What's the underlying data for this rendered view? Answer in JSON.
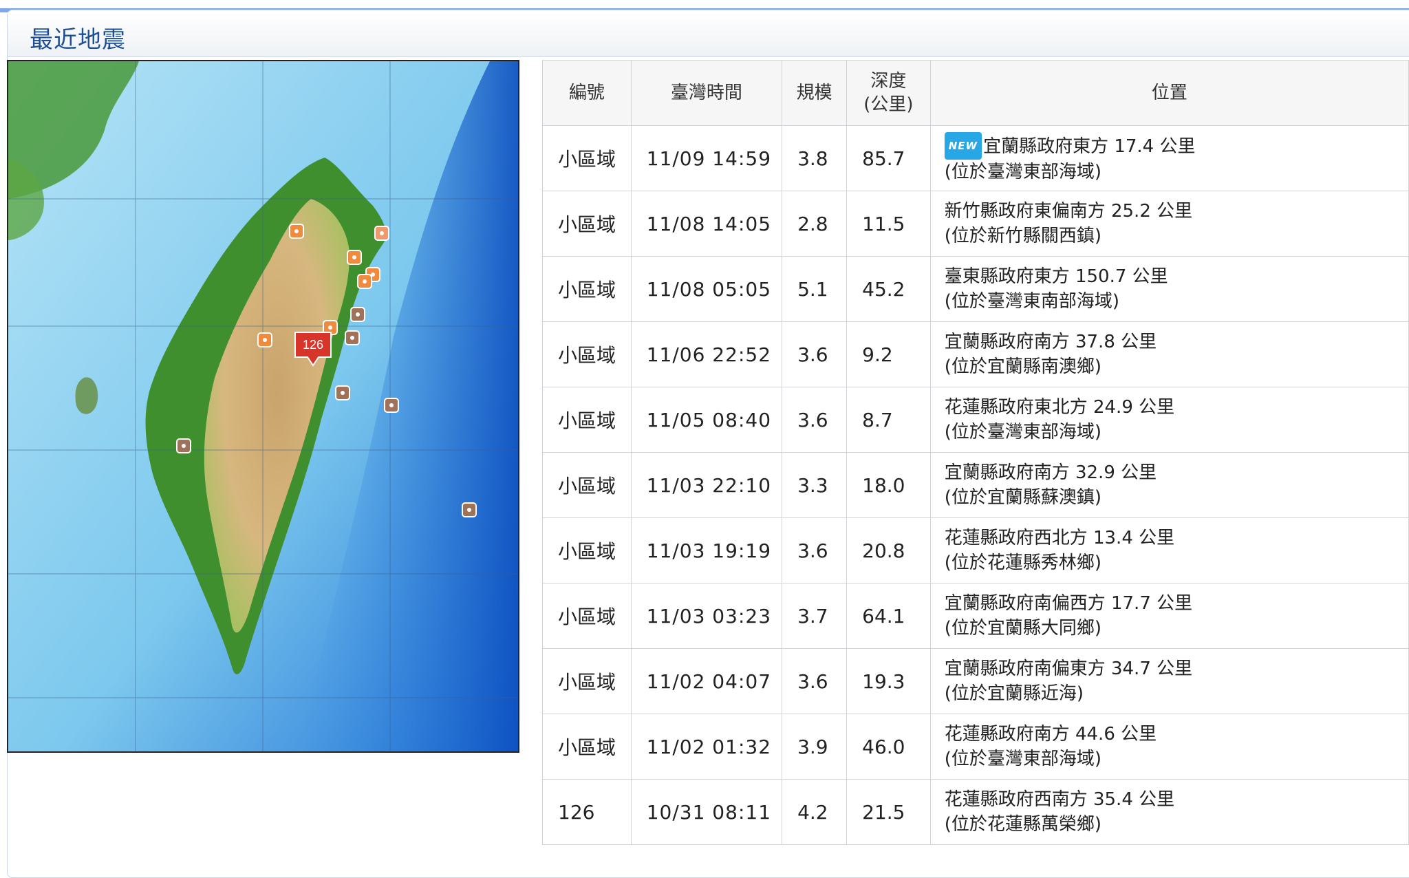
{
  "panel": {
    "title": "最近地震"
  },
  "table": {
    "headers": {
      "id": "編號",
      "time": "臺灣時間",
      "magnitude": "規模",
      "depth_line1": "深度",
      "depth_line2": "(公里)",
      "location": "位置"
    },
    "rows": [
      {
        "id": "小區域",
        "time": "11/09 14:59",
        "mag": "3.8",
        "depth": "85.7",
        "new": "NEW",
        "loc": "宜蘭縣政府東方 17.4 公里",
        "sub": "(位於臺灣東部海域)"
      },
      {
        "id": "小區域",
        "time": "11/08 14:05",
        "mag": "2.8",
        "depth": "11.5",
        "new": "",
        "loc": "新竹縣政府東偏南方 25.2 公里",
        "sub": "(位於新竹縣關西鎮)"
      },
      {
        "id": "小區域",
        "time": "11/08 05:05",
        "mag": "5.1",
        "depth": "45.2",
        "new": "",
        "loc": "臺東縣政府東方 150.7 公里",
        "sub": "(位於臺灣東南部海域)"
      },
      {
        "id": "小區域",
        "time": "11/06 22:52",
        "mag": "3.6",
        "depth": "9.2",
        "new": "",
        "loc": "宜蘭縣政府南方 37.8 公里",
        "sub": "(位於宜蘭縣南澳鄉)"
      },
      {
        "id": "小區域",
        "time": "11/05 08:40",
        "mag": "3.6",
        "depth": "8.7",
        "new": "",
        "loc": "花蓮縣政府東北方 24.9 公里",
        "sub": "(位於臺灣東部海域)"
      },
      {
        "id": "小區域",
        "time": "11/03 22:10",
        "mag": "3.3",
        "depth": "18.0",
        "new": "",
        "loc": "宜蘭縣政府南方 32.9 公里",
        "sub": "(位於宜蘭縣蘇澳鎮)"
      },
      {
        "id": "小區域",
        "time": "11/03 19:19",
        "mag": "3.6",
        "depth": "20.8",
        "new": "",
        "loc": "花蓮縣政府西北方 13.4 公里",
        "sub": "(位於花蓮縣秀林鄉)"
      },
      {
        "id": "小區域",
        "time": "11/03 03:23",
        "mag": "3.7",
        "depth": "64.1",
        "new": "",
        "loc": "宜蘭縣政府南偏西方 17.7 公里",
        "sub": "(位於宜蘭縣大同鄉)"
      },
      {
        "id": "小區域",
        "time": "11/02 04:07",
        "mag": "3.6",
        "depth": "19.3",
        "new": "",
        "loc": "宜蘭縣政府南偏東方 34.7 公里",
        "sub": "(位於宜蘭縣近海)"
      },
      {
        "id": "小區域",
        "time": "11/02 01:32",
        "mag": "3.9",
        "depth": "46.0",
        "new": "",
        "loc": "花蓮縣政府南方 44.6 公里",
        "sub": "(位於臺灣東部海域)"
      },
      {
        "id": "126",
        "time": "10/31 08:11",
        "mag": "4.2",
        "depth": "21.5",
        "new": "",
        "loc": "花蓮縣政府西南方 35.4 公里",
        "sub": "(位於花蓮縣萬榮鄉)"
      }
    ]
  },
  "map": {
    "highlight_label": "126",
    "colors": {
      "recent_marker": "#f08a3c",
      "older_marker": "#a0725a",
      "highlight": "#d8352a"
    }
  }
}
